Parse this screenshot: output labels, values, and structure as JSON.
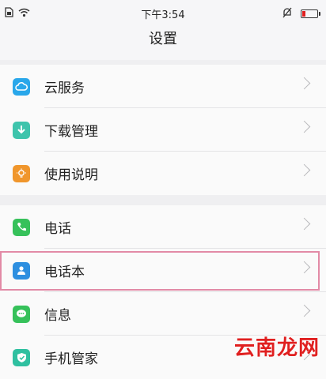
{
  "status_bar": {
    "time": "下午3:54"
  },
  "header": {
    "title": "设置"
  },
  "groups": [
    {
      "items": [
        {
          "label": "云服务",
          "icon": "cloud-icon",
          "color": "#29a7ea"
        },
        {
          "label": "下载管理",
          "icon": "download-icon",
          "color": "#3ec4ac"
        },
        {
          "label": "使用说明",
          "icon": "bulb-icon",
          "color": "#f0962c"
        }
      ]
    },
    {
      "items": [
        {
          "label": "电话",
          "icon": "phone-icon",
          "color": "#36c15a"
        },
        {
          "label": "电话本",
          "icon": "contacts-icon",
          "color": "#2d8fe0"
        },
        {
          "label": "信息",
          "icon": "message-icon",
          "color": "#36c15a"
        },
        {
          "label": "手机管家",
          "icon": "shield-icon",
          "color": "#2fc0a0"
        }
      ]
    }
  ],
  "watermark": "云南龙网"
}
